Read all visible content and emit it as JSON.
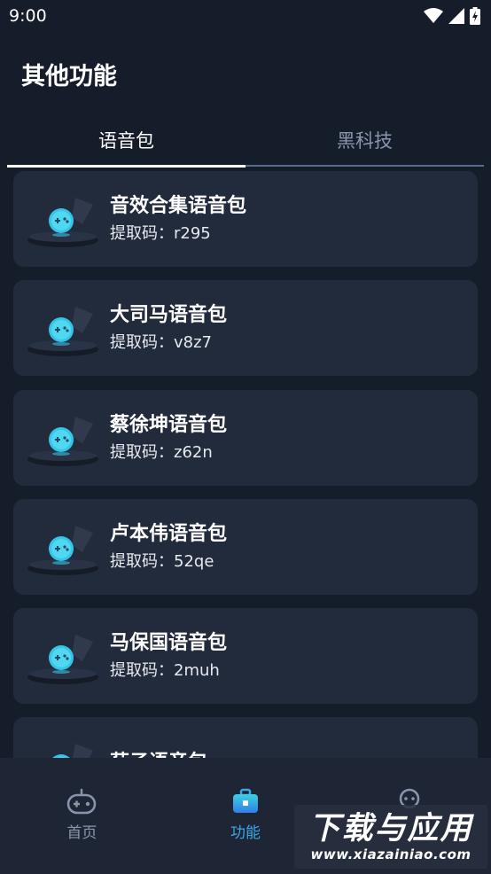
{
  "status_bar": {
    "time": "9:00",
    "icons": [
      "wifi-icon",
      "signal-icon",
      "battery-charging-icon"
    ]
  },
  "page": {
    "title": "其他功能"
  },
  "tabs": [
    {
      "label": "语音包",
      "active": true
    },
    {
      "label": "黑科技",
      "active": false
    }
  ],
  "packs": [
    {
      "title": "音效合集语音包",
      "code": "提取码：r295"
    },
    {
      "title": "大司马语音包",
      "code": "提取码：v8z7"
    },
    {
      "title": "蔡徐坤语音包",
      "code": "提取码：z62n"
    },
    {
      "title": "卢本伟语音包",
      "code": "提取码：52qe"
    },
    {
      "title": "马保国语音包",
      "code": "提取码：2muh"
    },
    {
      "title": "茄子语音包",
      "code": ""
    }
  ],
  "bottom_nav": [
    {
      "label": "首页",
      "icon": "gamepad-icon",
      "active": false
    },
    {
      "label": "功能",
      "icon": "toolbox-icon",
      "active": true
    },
    {
      "label": "",
      "icon": "robot-icon",
      "active": false
    }
  ],
  "watermark": {
    "main": "下载与应用",
    "url": "www.xiazainiao.com"
  },
  "colors": {
    "background": "#161d2a",
    "card": "#222b3b",
    "accent": "#3aa6e8",
    "inactive": "#8a95ad"
  }
}
